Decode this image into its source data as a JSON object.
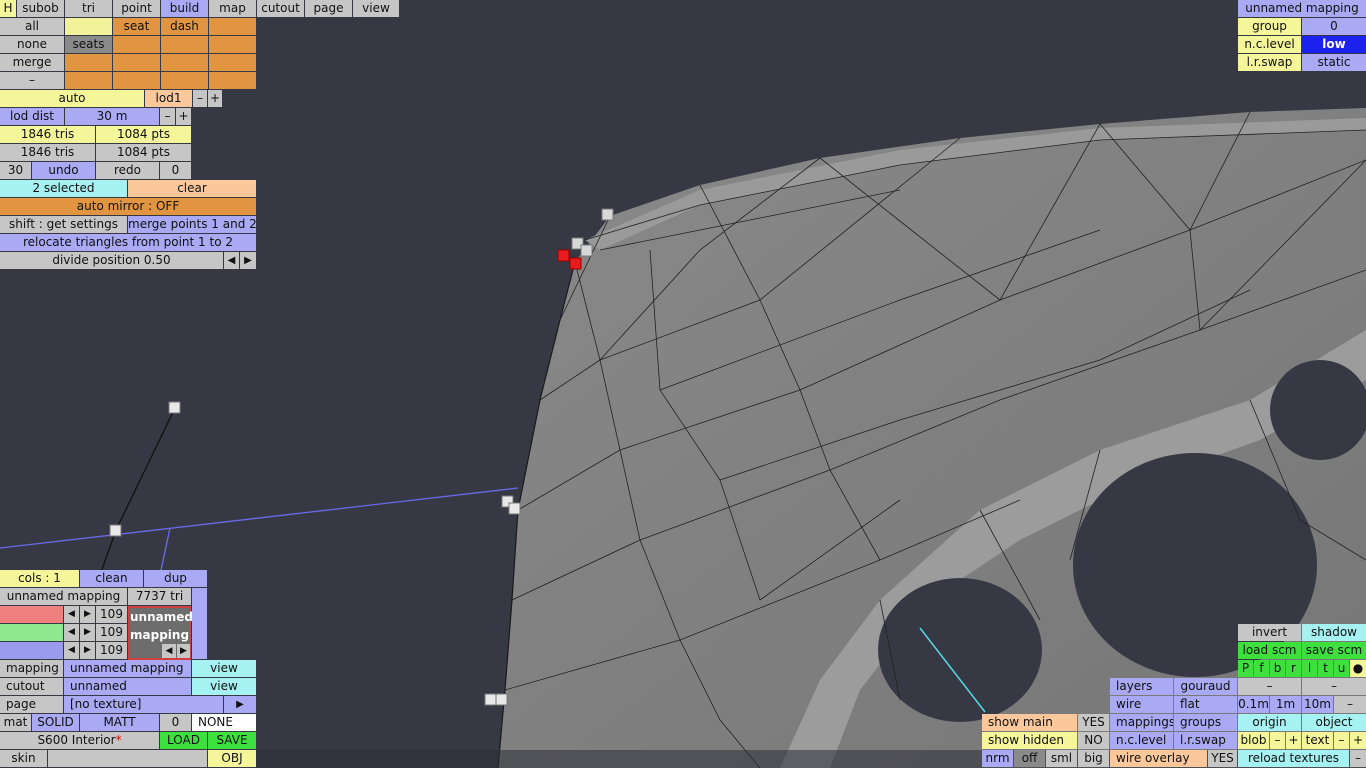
{
  "app": {
    "title": "S600 Interior"
  },
  "top_tabs": {
    "h": "H",
    "subob": "subob",
    "tri": "tri",
    "point": "point",
    "build": "build",
    "map": "map",
    "cutout": "cutout",
    "page": "page",
    "view": "view"
  },
  "select_panel": {
    "all": "all",
    "none": "none",
    "merge": "merge",
    "minus": "–",
    "seat": "seat",
    "dash": "dash",
    "seats": "seats"
  },
  "lod": {
    "auto": "auto",
    "lod1": "lod1",
    "minus": "–",
    "plus": "+",
    "lod_dist_label": "lod dist",
    "lod_dist_value": "30 m",
    "tris1": "1846 tris",
    "pts1": "1084 pts",
    "tris2": "1846 tris",
    "pts2": "1084 pts"
  },
  "history": {
    "count": "30",
    "undo": "undo",
    "redo": "redo",
    "redo_count": "0"
  },
  "selection": {
    "selected": "2 selected",
    "clear": "clear",
    "auto_mirror": "auto mirror : OFF",
    "get_settings": "shift : get settings",
    "merge_points": "merge points 1 and 2",
    "relocate": "relocate triangles from point 1 to 2",
    "divide": "divide position 0.50",
    "left_arrow": "◀",
    "right_arrow": "▶"
  },
  "mapping_panel": {
    "cols": "cols : 1",
    "clean": "clean",
    "dup": "dup",
    "name": "unnamed mapping",
    "tri_count": "7737 tri",
    "r_value": "109",
    "g_value": "109",
    "b_value": "109",
    "preview_line1": "unnamed",
    "preview_line2": "mapping",
    "mapping_label": "mapping",
    "mapping_value": "unnamed mapping",
    "mapping_view": "view",
    "cutout_label": "cutout",
    "cutout_value": "unnamed",
    "cutout_view": "view",
    "page_label": "page",
    "page_value": "[no texture]",
    "page_arrow": "▶",
    "mat": "mat",
    "solid": "SOLID",
    "matt": "MATT",
    "mat_num": "0",
    "none": "NONE",
    "file_name": "S600 Interior",
    "modified_mark": "*",
    "load": "LOAD",
    "save": "SAVE",
    "skin": "skin",
    "obj": "OBJ"
  },
  "top_right": {
    "mapping_name": "unnamed mapping",
    "group_label": "group",
    "group_value": "0",
    "nc_level_label": "n.c.level",
    "nc_level_value": "low",
    "lr_swap_label": "l.r.swap",
    "lr_swap_value": "static"
  },
  "bottom_right": {
    "invert": "invert",
    "shadow": "shadow",
    "load_scm": "load scm",
    "save_scm": "save scm",
    "flags": [
      "P",
      "f",
      "b",
      "r",
      "l",
      "t",
      "u",
      "●"
    ],
    "dash1": "–",
    "dash2": "–",
    "layers": "layers",
    "gouraud": "gouraud",
    "wire": "wire",
    "flat": "flat",
    "mappings": "mappings",
    "groups": "groups",
    "nc_level": "n.c.level",
    "lr_swap": "l.r.swap",
    "wire_overlay": "wire overlay",
    "wire_overlay_value": "YES",
    "show_main": "show main",
    "show_main_value": "YES",
    "show_hidden": "show hidden",
    "show_hidden_value": "NO",
    "nrm": "nrm",
    "off": "off",
    "sml": "sml",
    "big": "big",
    "scale_01": "0.1m",
    "scale_1": "1m",
    "scale_10": "10m",
    "scale_minus": "–",
    "origin": "origin",
    "object": "object",
    "blob": "blob",
    "blob_minus": "–",
    "blob_plus": "+",
    "text": "text",
    "text_minus": "–",
    "text_plus": "+",
    "reload_textures": "reload textures",
    "reload_minus": "–"
  },
  "colors": {
    "background": "#363944",
    "mesh": "#7c7c7c",
    "wire": "#222222",
    "guide_line": "#6a6ae8",
    "cyan_line": "#57d9e3",
    "selected_point": "#e81c1c",
    "accent_blue": "#a9a9f4",
    "accent_orange": "#e29540",
    "accent_yellow": "#f5f59a"
  }
}
